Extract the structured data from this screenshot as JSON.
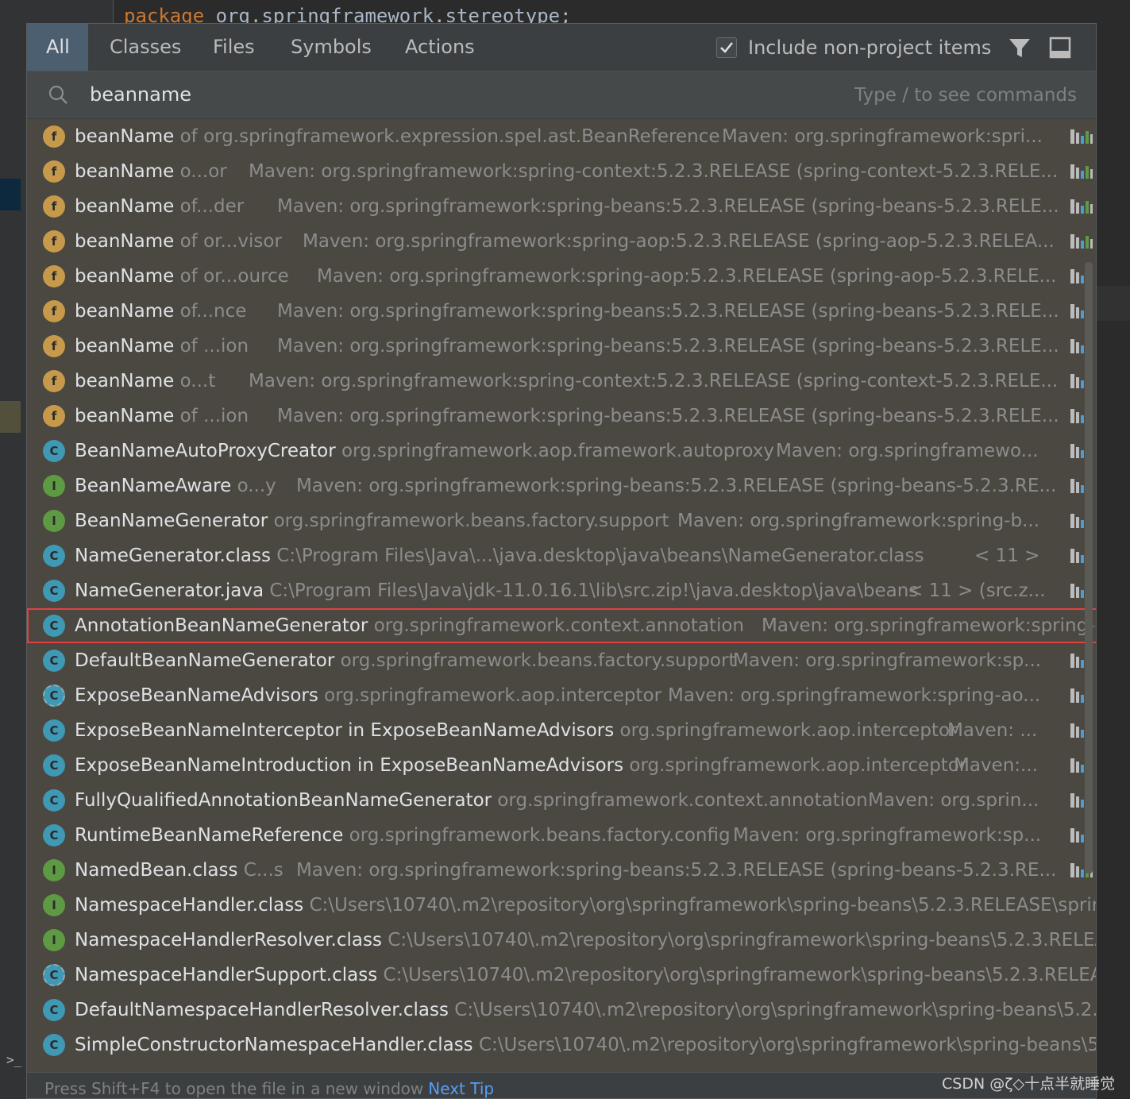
{
  "editor": {
    "code_keyword": "package",
    "code_package": "org.springframework.stereotype;"
  },
  "tabs": [
    {
      "label": "All",
      "active": true
    },
    {
      "label": "Classes",
      "active": false
    },
    {
      "label": "Files",
      "active": false
    },
    {
      "label": "Symbols",
      "active": false
    },
    {
      "label": "Actions",
      "active": false
    }
  ],
  "include_non_project": {
    "label": "Include non-project items",
    "checked": true
  },
  "search": {
    "value": "beanname",
    "hint": "Type / to see commands"
  },
  "results": [
    {
      "icon": "field",
      "name": "beanName",
      "loc": " of org.springframework.expression.spel.ast.BeanReference",
      "maven": "Maven: org.springframework:spri..."
    },
    {
      "icon": "field",
      "name": "beanName",
      "loc": " o...or",
      "maven": "Maven: org.springframework:spring-context:5.2.3.RELEASE (spring-context-5.2.3.RELE..."
    },
    {
      "icon": "field",
      "name": "beanName",
      "loc": " of...der",
      "maven": "Maven: org.springframework:spring-beans:5.2.3.RELEASE (spring-beans-5.2.3.RELE..."
    },
    {
      "icon": "field",
      "name": "beanName",
      "loc": " of or...visor",
      "maven": "Maven: org.springframework:spring-aop:5.2.3.RELEASE (spring-aop-5.2.3.RELEA..."
    },
    {
      "icon": "field",
      "name": "beanName",
      "loc": " of or...ource",
      "maven": "Maven: org.springframework:spring-aop:5.2.3.RELEASE (spring-aop-5.2.3.RELE..."
    },
    {
      "icon": "field",
      "name": "beanName",
      "loc": " of...nce",
      "maven": "Maven: org.springframework:spring-beans:5.2.3.RELEASE (spring-beans-5.2.3.RELE..."
    },
    {
      "icon": "field",
      "name": "beanName",
      "loc": " of ...ion",
      "maven": "Maven: org.springframework:spring-beans:5.2.3.RELEASE (spring-beans-5.2.3.RELE..."
    },
    {
      "icon": "field",
      "name": "beanName",
      "loc": " o...t",
      "maven": "Maven: org.springframework:spring-context:5.2.3.RELEASE (spring-context-5.2.3.RELE..."
    },
    {
      "icon": "field",
      "name": "beanName",
      "loc": " of ...ion",
      "maven": "Maven: org.springframework:spring-beans:5.2.3.RELEASE (spring-beans-5.2.3.RELE..."
    },
    {
      "icon": "class",
      "name": "BeanNameAutoProxyCreator",
      "loc": " org.springframework.aop.framework.autoproxy",
      "maven": "Maven: org.springframewo..."
    },
    {
      "icon": "interface",
      "name": "BeanNameAware",
      "loc": " o...y",
      "maven": "Maven: org.springframework:spring-beans:5.2.3.RELEASE (spring-beans-5.2.3.RE..."
    },
    {
      "icon": "interface",
      "name": "BeanNameGenerator",
      "loc": " org.springframework.beans.factory.support",
      "maven": "Maven: org.springframework:spring-b..."
    },
    {
      "icon": "class",
      "name": "NameGenerator.class",
      "loc": " C:\\Program Files\\Java\\...\\java.desktop\\java\\beans\\NameGenerator.class",
      "maven": "< 11 >"
    },
    {
      "icon": "class",
      "name": "NameGenerator.java",
      "loc": " C:\\Program Files\\Java\\jdk-11.0.16.1\\lib\\src.zip!\\java.desktop\\java\\beans",
      "maven": "< 11 > (src.z..."
    },
    {
      "icon": "class",
      "name": "AnnotationBeanNameGenerator",
      "loc": " org.springframework.context.annotation",
      "maven": "Maven: org.springframework:spring-c",
      "highlight": true
    },
    {
      "icon": "class",
      "name": "DefaultBeanNameGenerator",
      "loc": " org.springframework.beans.factory.support",
      "maven": "Maven: org.springframework:sp..."
    },
    {
      "icon": "abstract",
      "name": "ExposeBeanNameAdvisors",
      "loc": " org.springframework.aop.interceptor",
      "maven": "Maven: org.springframework:spring-ao..."
    },
    {
      "icon": "class",
      "name": "ExposeBeanNameInterceptor in ExposeBeanNameAdvisors",
      "loc": " org.springframework.aop.interceptor",
      "maven": "Maven: ..."
    },
    {
      "icon": "class",
      "name": "ExposeBeanNameIntroduction in ExposeBeanNameAdvisors",
      "loc": " org.springframework.aop.interceptor",
      "maven": "Maven:..."
    },
    {
      "icon": "class",
      "name": "FullyQualifiedAnnotationBeanNameGenerator",
      "loc": " org.springframework.context.annotation",
      "maven": "Maven: org.sprin..."
    },
    {
      "icon": "class",
      "name": "RuntimeBeanNameReference",
      "loc": " org.springframework.beans.factory.config",
      "maven": "Maven: org.springframework:sp..."
    },
    {
      "icon": "interface",
      "name": "NamedBean.class",
      "loc": " C...s",
      "maven": "Maven: org.springframework:spring-beans:5.2.3.RELEASE (spring-beans-5.2.3.RE..."
    },
    {
      "icon": "interface",
      "name": "NamespaceHandler.class",
      "loc": " C:\\Users\\10740\\.m2\\repository\\org\\springframework\\spring-beans\\5.2.3.RELEASE\\sprin",
      "maven": ""
    },
    {
      "icon": "interface",
      "name": "NamespaceHandlerResolver.class",
      "loc": " C:\\Users\\10740\\.m2\\repository\\org\\springframework\\spring-beans\\5.2.3.RELEA",
      "maven": ""
    },
    {
      "icon": "abstract",
      "name": "NamespaceHandlerSupport.class",
      "loc": " C:\\Users\\10740\\.m2\\repository\\org\\springframework\\spring-beans\\5.2.3.RELEA",
      "maven": ""
    },
    {
      "icon": "class",
      "name": "DefaultNamespaceHandlerResolver.class",
      "loc": " C:\\Users\\10740\\.m2\\repository\\org\\springframework\\spring-beans\\5.2.",
      "maven": ""
    },
    {
      "icon": "class",
      "name": "SimpleConstructorNamespaceHandler.class",
      "loc": " C:\\Users\\10740\\.m2\\repository\\org\\springframework\\spring-beans\\5",
      "maven": ""
    }
  ],
  "footer": {
    "tip": "Press Shift+F4 to open the file in a new window",
    "next": "Next Tip"
  },
  "watermark": "CSDN @ζ◇十点半就睡觉",
  "colors": {
    "accent_tab": "#4b5f70",
    "highlight_border": "#e54040",
    "link": "#589df6"
  }
}
